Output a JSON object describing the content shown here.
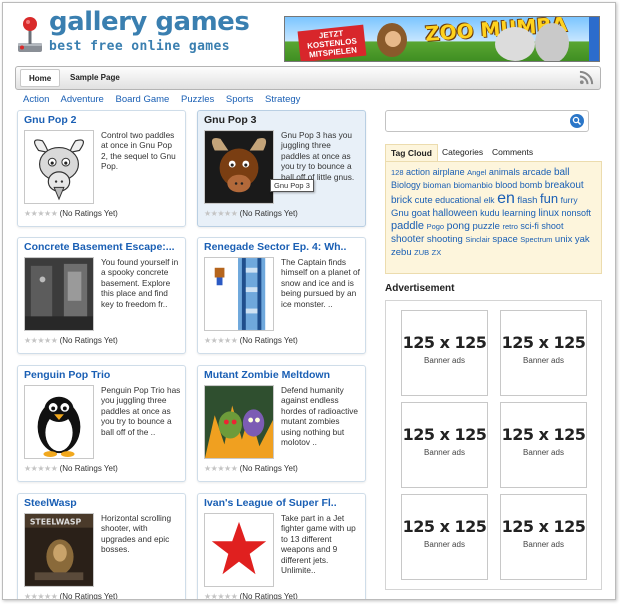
{
  "site": {
    "title": "gallery games",
    "tagline": "best free online games"
  },
  "banner": {
    "badge": "JETZT KOSTENLOS MITSPIELEN",
    "title": "ZOO MUMBA"
  },
  "nav": {
    "home": "Home",
    "sample": "Sample Page"
  },
  "categories": [
    "Action",
    "Adventure",
    "Board Game",
    "Puzzles",
    "Sports",
    "Strategy"
  ],
  "games": [
    {
      "title": "Gnu Pop 2",
      "desc": "Control two paddles at once in Gnu Pop 2, the sequel to Gnu Pop.",
      "rating": "(No Ratings Yet)"
    },
    {
      "title": "Gnu Pop 3",
      "desc": "Gnu Pop 3 has you juggling three paddles at once as you try to bounce a ball off of little gnus.",
      "rating": "(No Ratings Yet)"
    },
    {
      "title": "Concrete Basement Escape:...",
      "desc": "You found yourself in a spooky concrete basement. Explore this place and find key to freedom fr..",
      "rating": "(No Ratings Yet)"
    },
    {
      "title": "Renegade Sector Ep. 4: Wh..",
      "desc": "The Captain finds himself on a planet of snow and ice and is being pursued by an ice monster. ..",
      "rating": "(No Ratings Yet)"
    },
    {
      "title": "Penguin Pop Trio",
      "desc": "Penguin Pop Trio has you juggling three paddles at once as you try to bounce a ball off of the ..",
      "rating": "(No Ratings Yet)"
    },
    {
      "title": "Mutant Zombie Meltdown",
      "desc": "Defend humanity against endless hordes of radioactive mutant zombies using nothing but molotov ..",
      "rating": "(No Ratings Yet)"
    },
    {
      "title": "SteelWasp",
      "desc": "Horizontal scrolling shooter, with upgrades and epic bosses.",
      "rating": "(No Ratings Yet)"
    },
    {
      "title": "Ivan's League of Super Fl..",
      "desc": "Take part in a Jet fighter game with up to 13 different weapons and 9 different jets. Unlimite..",
      "rating": "(No Ratings Yet)"
    }
  ],
  "tooltip": "Gnu Pop 3",
  "thumbs": {
    "steelwasp": "STEELWASP"
  },
  "sidebar": {
    "search_placeholder": "",
    "tabs": [
      "Tag Cloud",
      "Categories",
      "Comments"
    ],
    "tags": [
      "128",
      "action",
      "airplane",
      "Angel",
      "animals",
      "arcade",
      "ball",
      "Biology",
      "bioman",
      "biomanbio",
      "blood",
      "bomb",
      "breakout",
      "brick",
      "cute",
      "educational",
      "elk",
      "en",
      "flash",
      "fun",
      "furry",
      "Gnu",
      "goat",
      "halloween",
      "kudu",
      "learning",
      "linux",
      "nonsoft",
      "paddle",
      "Pogo",
      "pong",
      "puzzle",
      "retro",
      "sci-fi",
      "shoot",
      "shooter",
      "shooting",
      "Sinclair",
      "space",
      "Spectrum",
      "unix",
      "yak",
      "zebu",
      "ZUB",
      "ZX"
    ],
    "ad_title": "Advertisement",
    "ads": [
      {
        "size": "125 x 125",
        "label": "Banner ads"
      },
      {
        "size": "125 x 125",
        "label": "Banner ads"
      },
      {
        "size": "125 x 125",
        "label": "Banner ads"
      },
      {
        "size": "125 x 125",
        "label": "Banner ads"
      },
      {
        "size": "125 x 125",
        "label": "Banner ads"
      },
      {
        "size": "125 x 125",
        "label": "Banner ads"
      }
    ]
  },
  "colors": {
    "link": "#1a5fb4",
    "brand": "#3a7fb0",
    "tag_bg": "#fdf5dc"
  }
}
